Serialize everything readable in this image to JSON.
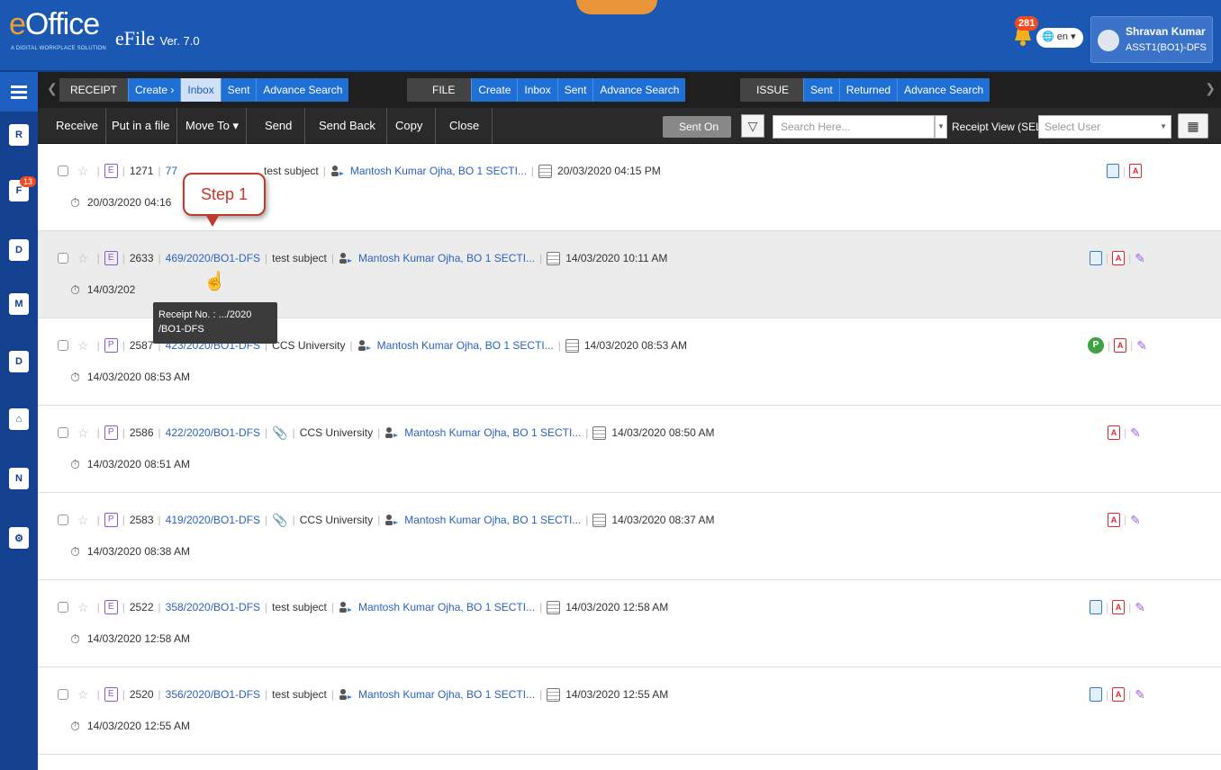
{
  "header": {
    "logo_text_e": "e",
    "logo_text_rest": "Office",
    "logo_tagline": "A DIGITAL WORKPLACE SOLUTION",
    "app_name": "eFile",
    "version": "Ver. 7.0",
    "notification_count": "281",
    "language": "en",
    "user_name": "Shravan Kumar",
    "user_role": "ASST1(BO1)-DFS"
  },
  "sidebar": {
    "items": [
      {
        "name": "menu",
        "icon": "hamburger-icon"
      },
      {
        "name": "receipt",
        "icon": "receipt-icon",
        "label": "R"
      },
      {
        "name": "file",
        "icon": "file-icon",
        "label": "F",
        "badge": "13"
      },
      {
        "name": "dak",
        "icon": "dak-icon",
        "label": "D"
      },
      {
        "name": "movement",
        "icon": "movement-icon",
        "label": "M"
      },
      {
        "name": "dsc",
        "icon": "dsc-icon",
        "label": "D"
      },
      {
        "name": "home",
        "icon": "home-icon",
        "label": "⌂"
      },
      {
        "name": "notings",
        "icon": "note-icon",
        "label": "N"
      },
      {
        "name": "settings",
        "icon": "settings-icon",
        "label": "⚙"
      }
    ]
  },
  "tabs": {
    "receipt": {
      "head": "RECEIPT",
      "items": [
        "Create ›",
        "Inbox",
        "Sent",
        "Advance Search"
      ]
    },
    "file": {
      "head": "FILE",
      "items": [
        "Create",
        "Inbox",
        "Sent",
        "Advance Search"
      ]
    },
    "issue": {
      "head": "ISSUE",
      "items": [
        "Sent",
        "Returned",
        "Advance Search"
      ]
    }
  },
  "toolbar": {
    "receive": "Receive",
    "put_in_file": "Put in a file",
    "move_to": "Move To ▾",
    "send": "Send",
    "send_back": "Send Back",
    "copy": "Copy",
    "close": "Close",
    "sent_on": "Sent On",
    "search_placeholder": "Search Here...",
    "receipt_view": "Receipt View (SELF)",
    "select_user": "Select User"
  },
  "rows": [
    {
      "type": "E",
      "num": "1271",
      "receipt": "77",
      "attach": false,
      "subject": "test subject",
      "sender": "Mantosh Kumar Ojha, BO 1 SECTI...",
      "sent_on": "20/03/2020 04:15 PM",
      "due": "20/03/2020 04:16",
      "icons": [
        "doc",
        "pdf"
      ]
    },
    {
      "type": "E",
      "num": "2633",
      "receipt": "469/2020/BO1-DFS",
      "attach": false,
      "subject": "test subject",
      "sender": "Mantosh Kumar Ojha, BO 1 SECTI...",
      "sent_on": "14/03/2020 10:11 AM",
      "due": "14/03/202",
      "icons": [
        "doc",
        "pdf",
        "pen"
      ]
    },
    {
      "type": "P",
      "num": "2587",
      "receipt": "423/2020/BO1-DFS",
      "attach": false,
      "subject": "CCS University",
      "sender": "Mantosh Kumar Ojha, BO 1 SECTI...",
      "sent_on": "14/03/2020 08:53 AM",
      "due": "14/03/2020 08:53 AM",
      "icons": [
        "p",
        "pdf",
        "pen"
      ]
    },
    {
      "type": "P",
      "num": "2586",
      "receipt": "422/2020/BO1-DFS",
      "attach": true,
      "subject": "CCS University",
      "sender": "Mantosh Kumar Ojha, BO 1 SECTI...",
      "sent_on": "14/03/2020 08:50 AM",
      "due": "14/03/2020 08:51 AM",
      "icons": [
        "pdf",
        "pen"
      ]
    },
    {
      "type": "P",
      "num": "2583",
      "receipt": "419/2020/BO1-DFS",
      "attach": true,
      "subject": "CCS University",
      "sender": "Mantosh Kumar Ojha, BO 1 SECTI...",
      "sent_on": "14/03/2020 08:37 AM",
      "due": "14/03/2020 08:38 AM",
      "icons": [
        "pdf",
        "pen"
      ]
    },
    {
      "type": "E",
      "num": "2522",
      "receipt": "358/2020/BO1-DFS",
      "attach": false,
      "subject": "test subject",
      "sender": "Mantosh Kumar Ojha, BO 1 SECTI...",
      "sent_on": "14/03/2020 12:58 AM",
      "due": "14/03/2020 12:58 AM",
      "icons": [
        "doc",
        "pdf",
        "pen"
      ]
    },
    {
      "type": "E",
      "num": "2520",
      "receipt": "356/2020/BO1-DFS",
      "attach": false,
      "subject": "test subject",
      "sender": "Mantosh Kumar Ojha, BO 1 SECTI...",
      "sent_on": "14/03/2020 12:55 AM",
      "due": "14/03/2020 12:55 AM",
      "icons": [
        "doc",
        "pdf",
        "pen"
      ]
    }
  ],
  "callout": {
    "label": "Step 1"
  },
  "tooltip": {
    "line1": "Receipt No. : .../2020",
    "line2": "/BO1-DFS"
  },
  "colors": {
    "header": "#1a58b4",
    "sidebar": "#13418f",
    "tab_blue": "#1f6fd4",
    "callout_red": "#c0392b"
  }
}
